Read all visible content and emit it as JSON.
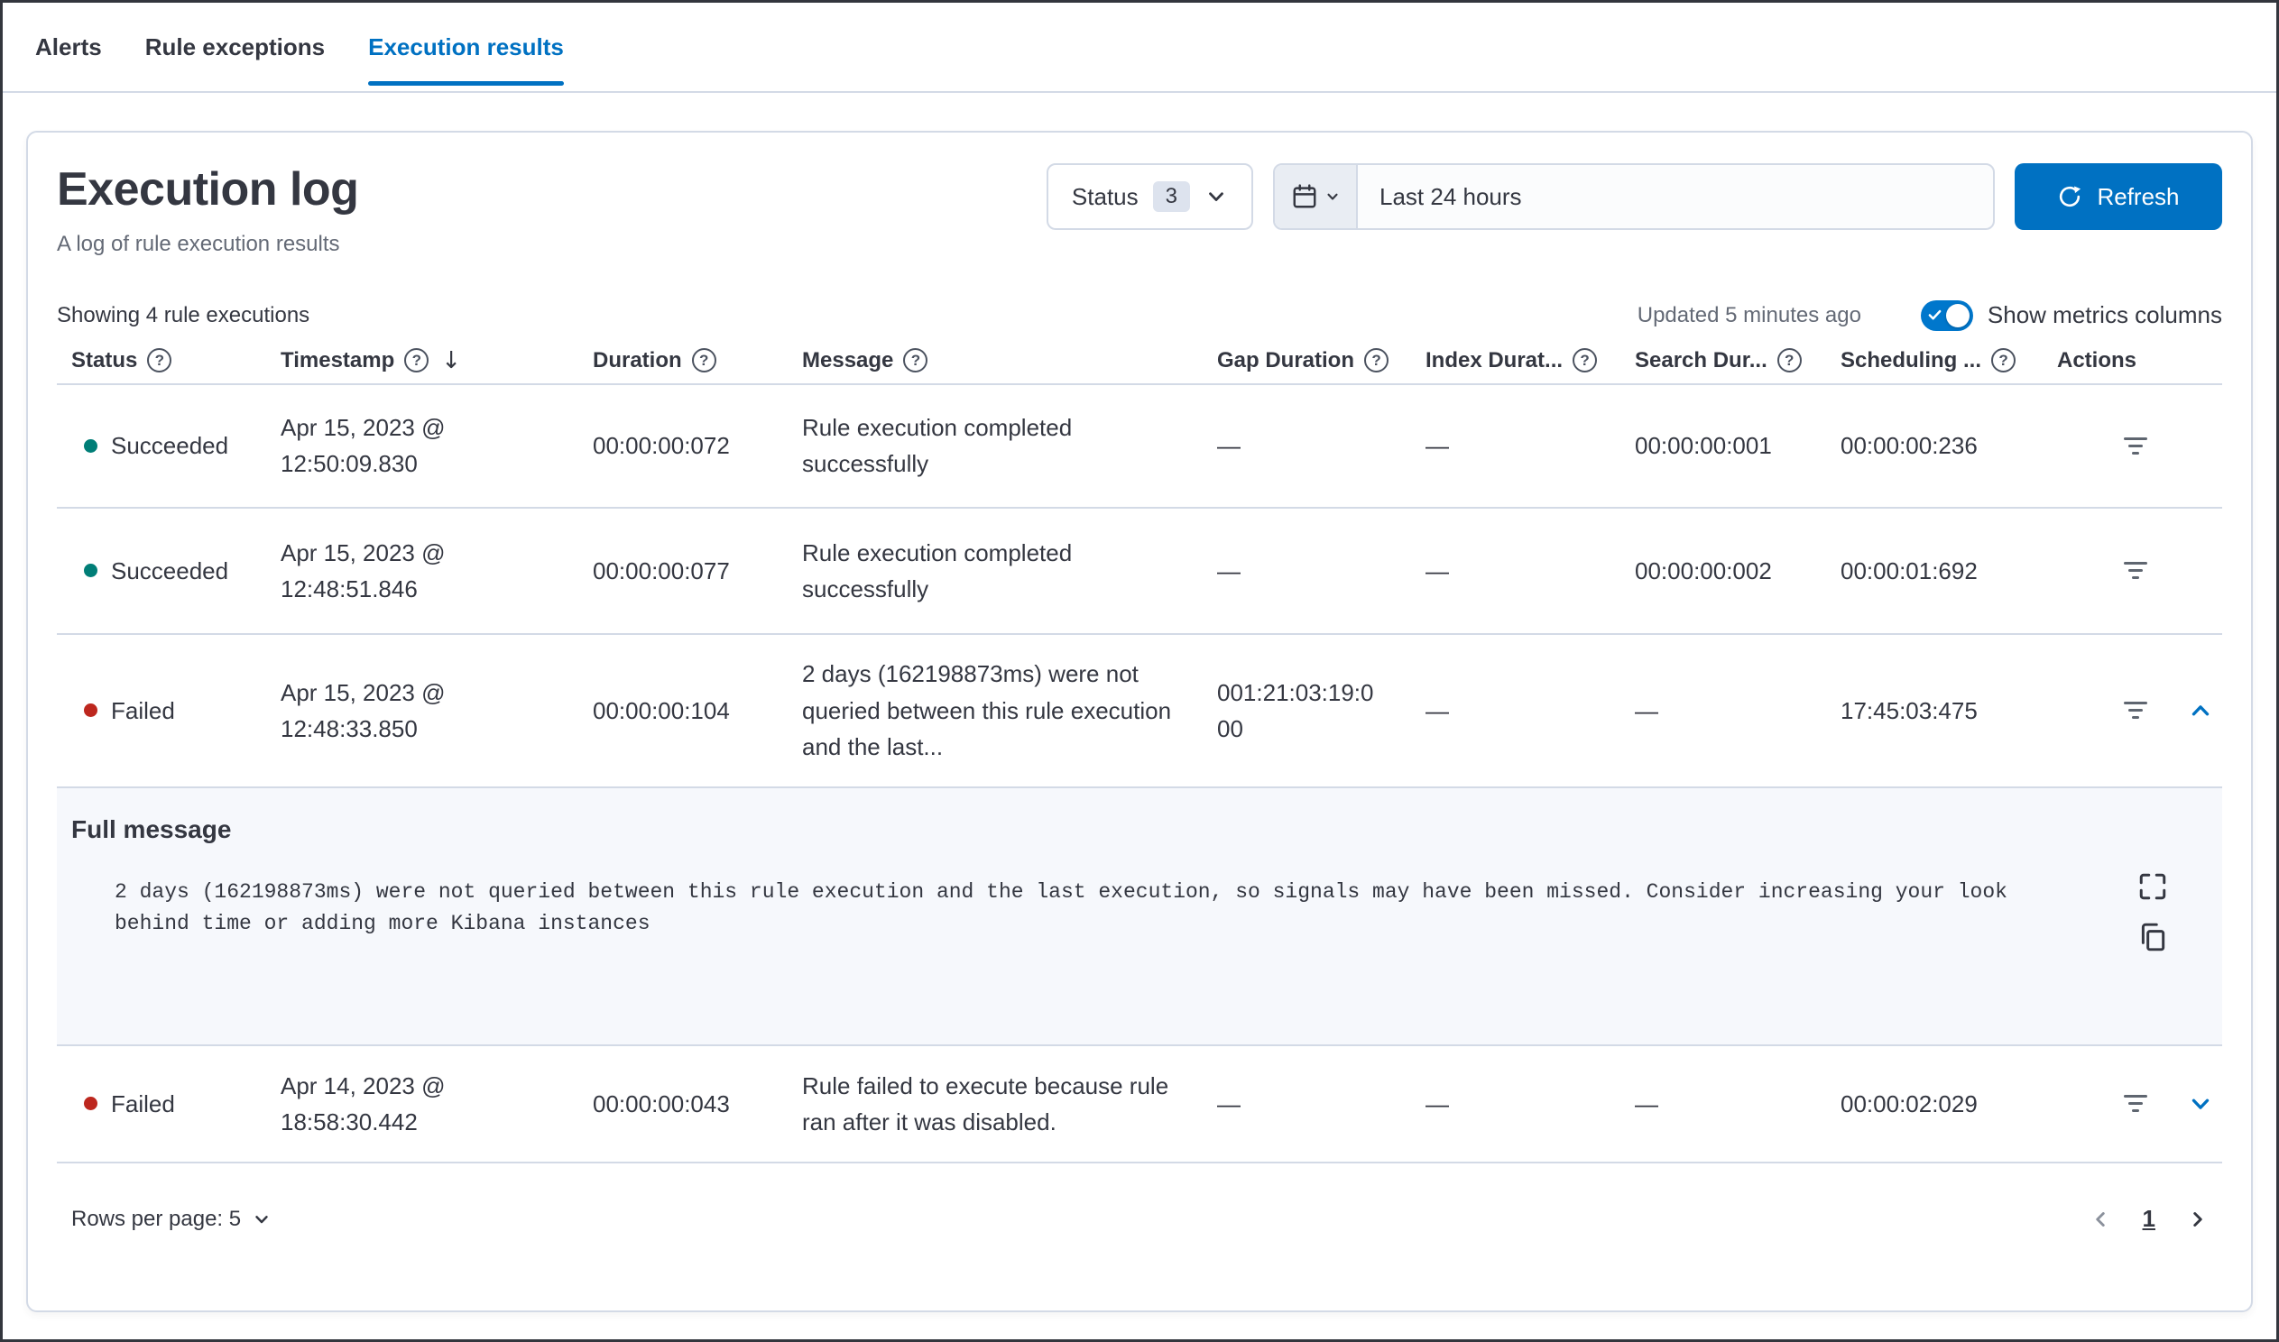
{
  "tabs": [
    {
      "label": "Alerts",
      "active": false
    },
    {
      "label": "Rule exceptions",
      "active": false
    },
    {
      "label": "Execution results",
      "active": true
    }
  ],
  "panel": {
    "title": "Execution log",
    "subtitle": "A log of rule execution results",
    "filters": {
      "status_label": "Status",
      "status_count": "3",
      "date_range": "Last 24 hours",
      "refresh_label": "Refresh"
    },
    "meta": {
      "showing": "Showing 4 rule executions",
      "updated": "Updated 5 minutes ago",
      "metrics_toggle_label": "Show metrics columns",
      "metrics_toggle_on": true
    },
    "table": {
      "columns": {
        "status": "Status",
        "timestamp": "Timestamp",
        "duration": "Duration",
        "message": "Message",
        "gap_duration": "Gap Duration",
        "index_duration": "Index Durat...",
        "search_duration": "Search Dur...",
        "scheduling_delay": "Scheduling ...",
        "actions": "Actions"
      },
      "rows": [
        {
          "status": "Succeeded",
          "timestamp": "Apr 15, 2023 @ 12:50:09.830",
          "duration": "00:00:00:072",
          "message": "Rule execution completed successfully",
          "gap_duration": "—",
          "index_duration": "—",
          "search_duration": "00:00:00:001",
          "scheduling_delay": "00:00:00:236"
        },
        {
          "status": "Succeeded",
          "timestamp": "Apr 15, 2023 @ 12:48:51.846",
          "duration": "00:00:00:077",
          "message": "Rule execution completed successfully",
          "gap_duration": "—",
          "index_duration": "—",
          "search_duration": "00:00:00:002",
          "scheduling_delay": "00:00:01:692"
        },
        {
          "status": "Failed",
          "timestamp": "Apr 15, 2023 @ 12:48:33.850",
          "duration": "00:00:00:104",
          "message": "2 days (162198873ms) were not queried between this rule execution and the last...",
          "gap_duration": "001:21:03:19:000",
          "index_duration": "—",
          "search_duration": "—",
          "scheduling_delay": "17:45:03:475",
          "expanded": true
        },
        {
          "status": "Failed",
          "timestamp": "Apr 14, 2023 @ 18:58:30.442",
          "duration": "00:00:00:043",
          "message": "Rule failed to execute because rule ran after it was disabled.",
          "gap_duration": "—",
          "index_duration": "—",
          "search_duration": "—",
          "scheduling_delay": "00:00:02:029",
          "expanded": false
        }
      ],
      "expanded_row": {
        "heading": "Full message",
        "message": "2 days (162198873ms) were not queried between this rule execution and the last execution, so signals may have been missed. Consider increasing your look behind time or adding more Kibana instances"
      }
    },
    "footer": {
      "rows_per_page": "Rows per page: 5",
      "page": "1"
    }
  },
  "colors": {
    "primary": "#0071c2",
    "success_dot": "#007e77",
    "danger_dot": "#bd271e",
    "border": "#d3dae6",
    "toggle_on": "#0077cc"
  }
}
